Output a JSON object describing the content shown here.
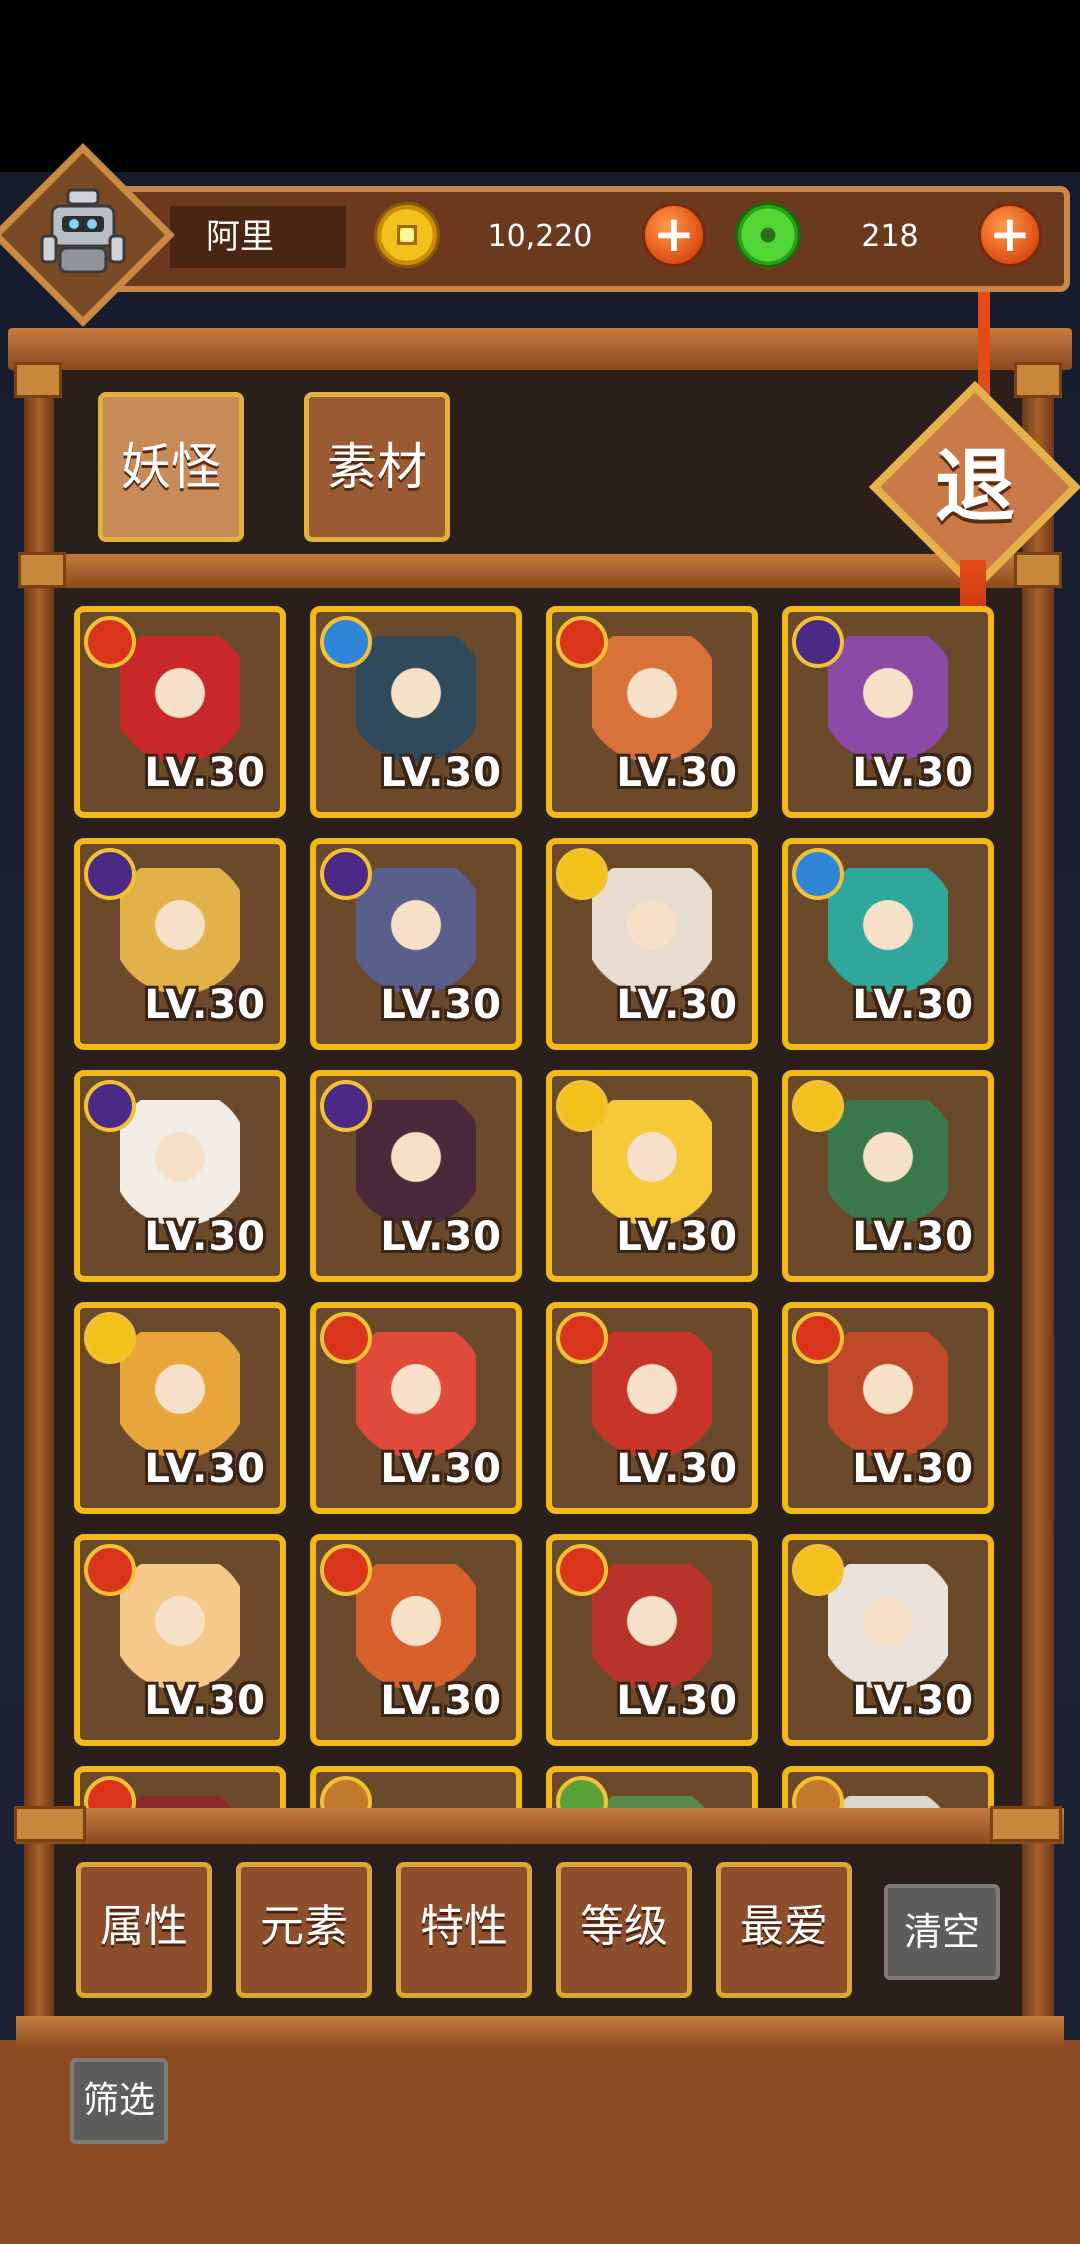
{
  "player": {
    "name": "阿里"
  },
  "currency": {
    "gold": {
      "amount": "10,220",
      "icon": "gold-coin-icon"
    },
    "jade": {
      "amount": "218",
      "icon": "jade-coin-icon"
    }
  },
  "tabs": [
    {
      "label": "妖怪",
      "selected": true
    },
    {
      "label": "素材",
      "selected": false
    }
  ],
  "exit": {
    "label": "退"
  },
  "element_colors": {
    "fire": "#d9351a",
    "water": "#2f86d9",
    "dark": "#4b2a86",
    "light": "#f2c21a",
    "earth": "#c27a2a",
    "wood": "#5aa13a"
  },
  "cards": [
    {
      "element": "fire",
      "art": "#c8282a",
      "level": "LV.30"
    },
    {
      "element": "water",
      "art": "#2f4a5a",
      "level": "LV.30"
    },
    {
      "element": "fire",
      "art": "#d9723a",
      "level": "LV.30"
    },
    {
      "element": "dark",
      "art": "#8a4aa6",
      "level": "LV.30"
    },
    {
      "element": "dark",
      "art": "#e2b24a",
      "level": "LV.30"
    },
    {
      "element": "dark",
      "art": "#5a5e8a",
      "level": "LV.30"
    },
    {
      "element": "light",
      "art": "#e8dcd0",
      "level": "LV.30"
    },
    {
      "element": "water",
      "art": "#2fa79a",
      "level": "LV.30"
    },
    {
      "element": "dark",
      "art": "#f2eee6",
      "level": "LV.30"
    },
    {
      "element": "dark",
      "art": "#4a2a3a",
      "level": "LV.30"
    },
    {
      "element": "light",
      "art": "#f5c93a",
      "level": "LV.30"
    },
    {
      "element": "light",
      "art": "#3a7a4a",
      "level": "LV.30"
    },
    {
      "element": "light",
      "art": "#e8a63a",
      "level": "LV.30"
    },
    {
      "element": "fire",
      "art": "#e04a3a",
      "level": "LV.30"
    },
    {
      "element": "fire",
      "art": "#c8342a",
      "level": "LV.30"
    },
    {
      "element": "fire",
      "art": "#c04a2a",
      "level": "LV.30"
    },
    {
      "element": "fire",
      "art": "#f5c98a",
      "level": "LV.30"
    },
    {
      "element": "fire",
      "art": "#d8602a",
      "level": "LV.30"
    },
    {
      "element": "fire",
      "art": "#b8342a",
      "level": "LV.30"
    },
    {
      "element": "light",
      "art": "#e8e2da",
      "level": "LV.30"
    },
    {
      "element": "fire",
      "art": "#8a2a2a",
      "level": ""
    },
    {
      "element": "earth",
      "art": "#6b4a2c",
      "level": ""
    },
    {
      "element": "wood",
      "art": "#5a8a4a",
      "level": ""
    },
    {
      "element": "earth",
      "art": "#dcd6cc",
      "level": ""
    }
  ],
  "filters": [
    {
      "label": "属性"
    },
    {
      "label": "元素"
    },
    {
      "label": "特性"
    },
    {
      "label": "等级"
    },
    {
      "label": "最爱"
    }
  ],
  "clear_label": "清空",
  "filter_label": "筛选"
}
